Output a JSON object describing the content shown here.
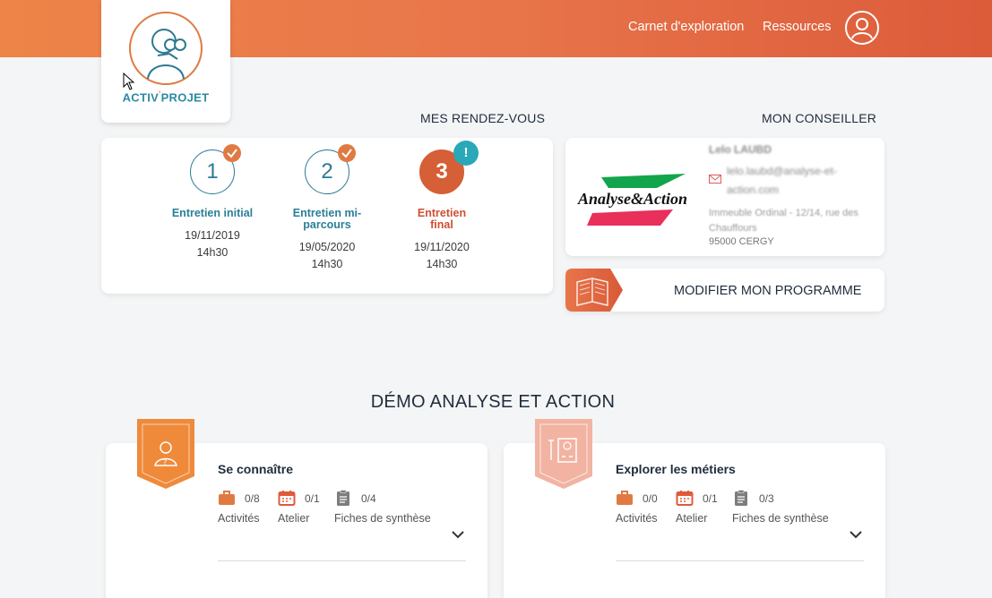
{
  "nav": {
    "explore": "Carnet d'exploration",
    "resources": "Ressources"
  },
  "logo": {
    "name_part1": "ACTIV",
    "name_sup": "'",
    "name_part2": "PROJET"
  },
  "rendezvous": {
    "heading": "MES RENDEZ-VOUS",
    "steps": [
      {
        "number": "1",
        "title": "Entretien initial",
        "date": "19/11/2019",
        "time": "14h30",
        "status": "done"
      },
      {
        "number": "2",
        "title": "Entretien mi-parcours",
        "date": "19/05/2020",
        "time": "14h30",
        "status": "done"
      },
      {
        "number": "3",
        "title": "Entretien final",
        "date": "19/11/2020",
        "time": "14h30",
        "status": "current",
        "badge": "!"
      }
    ]
  },
  "conseiller": {
    "heading": "MON CONSEILLER",
    "name": "Lelo LAUBD",
    "email": "lelo.laubd@analyse-et-action.com",
    "address": "Immeuble Ordinal - 12/14, rue des Chauffours",
    "city": "95000 CERGY",
    "org_logo_text": "Analyse&Action"
  },
  "programme_button": "MODIFIER MON PROGRAMME",
  "demo": {
    "title": "DÉMO ANALYSE ET ACTION",
    "modules": [
      {
        "title": "Se connaître",
        "stats": [
          {
            "icon": "briefcase-icon",
            "count": "0/8",
            "label": "Activités"
          },
          {
            "icon": "calendar-icon",
            "count": "0/1",
            "label": "Atelier"
          },
          {
            "icon": "clipboard-icon",
            "count": "0/4",
            "label": "Fiches de synthèse"
          }
        ]
      },
      {
        "title": "Explorer les métiers",
        "stats": [
          {
            "icon": "briefcase-icon",
            "count": "0/0",
            "label": "Activités"
          },
          {
            "icon": "calendar-icon",
            "count": "0/1",
            "label": "Atelier"
          },
          {
            "icon": "clipboard-icon",
            "count": "0/3",
            "label": "Fiches de synthèse"
          }
        ]
      }
    ]
  },
  "colors": {
    "primary": "#e8754a",
    "teal": "#2c7a92",
    "alert": "#2aa8b8"
  }
}
